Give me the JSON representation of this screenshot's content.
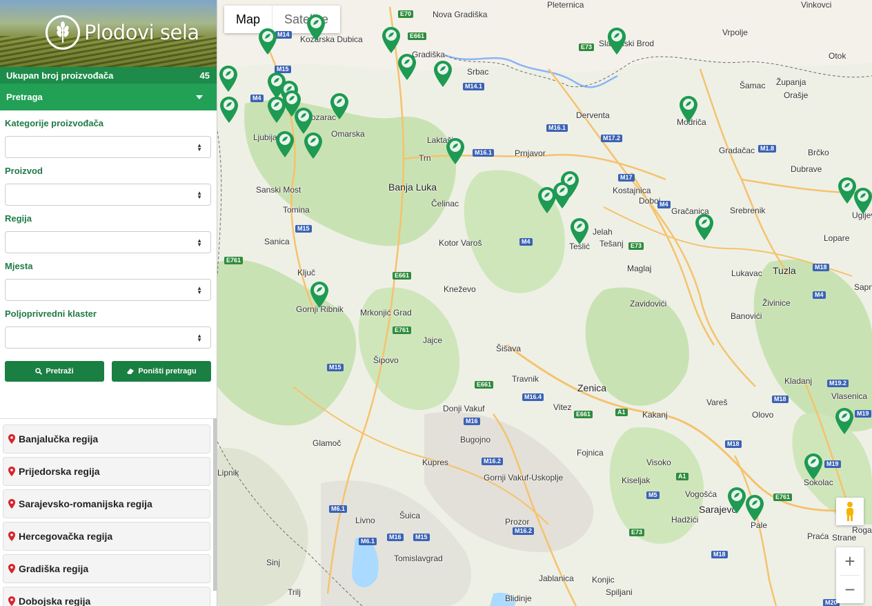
{
  "sidebar": {
    "logo_text": "Plodovi sela",
    "count_label": "Ukupan broj proizvođača",
    "count_value": "45",
    "search_header": "Pretraga",
    "filters": [
      {
        "label": "Kategorije proizvođača",
        "value": ""
      },
      {
        "label": "Proizvod",
        "value": ""
      },
      {
        "label": "Regija",
        "value": ""
      },
      {
        "label": "Mjesta",
        "value": ""
      },
      {
        "label": "Poljoprivredni klaster",
        "value": ""
      }
    ],
    "search_button": "Pretraži",
    "reset_button": "Poništi pretragu",
    "regions": [
      "Banjalučka regija",
      "Prijedorska regija",
      "Sarajevsko-romanijska regija",
      "Hercegovačka regija",
      "Gradiška regija",
      "Dobojska regija"
    ]
  },
  "map": {
    "type_options": [
      "Map",
      "Satellite"
    ],
    "selected_type": "Map",
    "places": [
      "Nova Gradiška",
      "Pleternica",
      "Vinkovci",
      "Kozarska Dubica",
      "Gradiška",
      "Srbac",
      "Slavonski Brod",
      "Vrpolje",
      "Otok",
      "Županja",
      "Šamac",
      "Orašje",
      "Derventa",
      "Modriča",
      "Gradačac",
      "Brčko",
      "Laktaši",
      "Prnjavor",
      "Banja Luka",
      "Čelinac",
      "Kotor Varoš",
      "Trn",
      "Omarska",
      "Kozarac",
      "Ljubija",
      "Sanski Most",
      "Tomina",
      "Sanica",
      "Ključ",
      "Gornji Ribnik",
      "Mrkonjić Grad",
      "Jajce",
      "Šipovo",
      "Kneževo",
      "Šišava",
      "Travnik",
      "Vitez",
      "Zenica",
      "Kakanj",
      "Donji Vakuf",
      "Bugojno",
      "Kupres",
      "Gornji Vakuf-Uskoplje",
      "Glamoč",
      "Livno",
      "Šuica",
      "Prozor",
      "Tomislavgrad",
      "Jablanica",
      "Konjic",
      "Spiljani",
      "Blidinje",
      "Sinj",
      "Trilj",
      "Fojnica",
      "Kiseljak",
      "Visoko",
      "Vogošća",
      "Sarajevo",
      "Hadžići",
      "Pale",
      "Sokolac",
      "Olovo",
      "Vareš",
      "Kladanj",
      "Vlasenica",
      "Živinice",
      "Banovići",
      "Tuzla",
      "Lukavac",
      "Srebrenik",
      "Gračanica",
      "Doboj",
      "Kostajnica",
      "Jelah",
      "Tešanj",
      "Teslić",
      "Maglaj",
      "Zavidovići",
      "Lopare",
      "Ugljevik",
      "Dubrave",
      "Praća",
      "Strane",
      "Rogatica",
      "Sapna",
      "Lipnik"
    ],
    "roads": [
      "E70",
      "E661",
      "M14",
      "M15",
      "M4",
      "M14.1",
      "E73",
      "M16.1",
      "M17.2",
      "M1.8",
      "M16.1",
      "M17",
      "E761",
      "M15",
      "M4",
      "E661",
      "M15",
      "E761",
      "E661",
      "M16.4",
      "M16",
      "M16.2",
      "E661",
      "A1",
      "M18",
      "M19.2",
      "M18",
      "M19",
      "E761",
      "A1",
      "M5",
      "E73",
      "M18",
      "M6.1",
      "M16",
      "M15",
      "M6.1",
      "M16.2",
      "M20",
      "M4",
      "E73",
      "M18",
      "M4",
      "M19"
    ],
    "zoom_in": "+",
    "zoom_out": "−",
    "marker_color": "#1e9a52",
    "accent_color": "#1e8b4a"
  }
}
